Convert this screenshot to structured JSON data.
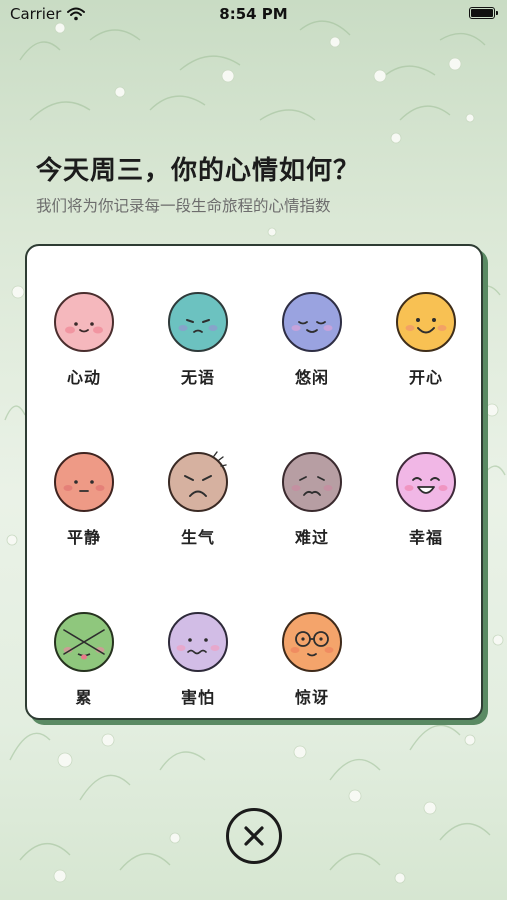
{
  "status_bar": {
    "carrier": "Carrier",
    "time": "8:54 PM"
  },
  "header": {
    "title": "今天周三，你的心情如何？",
    "subtitle": "我们将为你记录每一段生命旅程的心情指数"
  },
  "moods": [
    {
      "label": "心动",
      "color": "#f5b8bd",
      "icon": "heart-flutter-face-icon"
    },
    {
      "label": "无语",
      "color": "#6cc2c0",
      "icon": "speechless-face-icon"
    },
    {
      "label": "悠闲",
      "color": "#9aa3e0",
      "icon": "relaxed-face-icon"
    },
    {
      "label": "开心",
      "color": "#f8c153",
      "icon": "happy-face-icon"
    },
    {
      "label": "平静",
      "color": "#ee9a86",
      "icon": "calm-face-icon"
    },
    {
      "label": "生气",
      "color": "#d6b1a0",
      "icon": "angry-face-icon"
    },
    {
      "label": "难过",
      "color": "#b79ea3",
      "icon": "sad-face-icon"
    },
    {
      "label": "幸福",
      "color": "#f1b7e6",
      "icon": "blissful-face-icon"
    },
    {
      "label": "累",
      "color": "#8fc77d",
      "icon": "tired-face-icon"
    },
    {
      "label": "害怕",
      "color": "#d2bde6",
      "icon": "scared-face-icon"
    },
    {
      "label": "惊讶",
      "color": "#f4a46b",
      "icon": "surprised-face-icon"
    }
  ],
  "close_icon": "close-icon"
}
